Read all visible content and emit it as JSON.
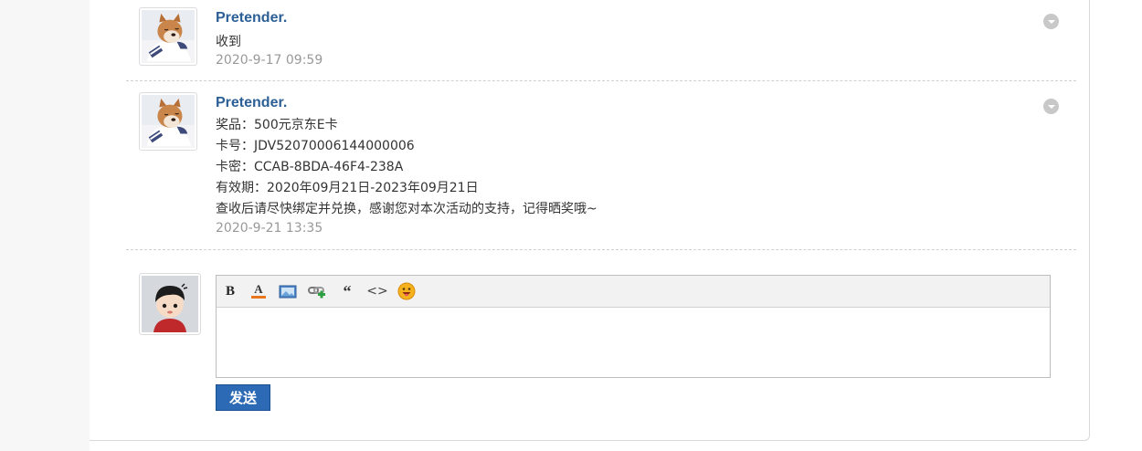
{
  "messages": [
    {
      "author": "Pretender.",
      "lines": [
        "收到"
      ],
      "time": "2020-9-17 09:59"
    },
    {
      "author": "Pretender.",
      "lines": [
        "奖品：500元京东E卡",
        "卡号：JDV52070006144000006",
        "卡密：CCAB-8BDA-46F4-238A",
        "有效期：2020年09月21日-2023年09月21日",
        "查收后请尽快绑定并兑换，感谢您对本次活动的支持，记得晒奖哦~"
      ],
      "time": "2020-9-21 13:35"
    }
  ],
  "toolbar": {
    "bold_label": "B",
    "quote_label": "“",
    "code_label": "<>"
  },
  "send_label": "发送",
  "colors": {
    "name": "#2b5f96",
    "send_button": "#2d6ab5",
    "time": "#999999"
  }
}
